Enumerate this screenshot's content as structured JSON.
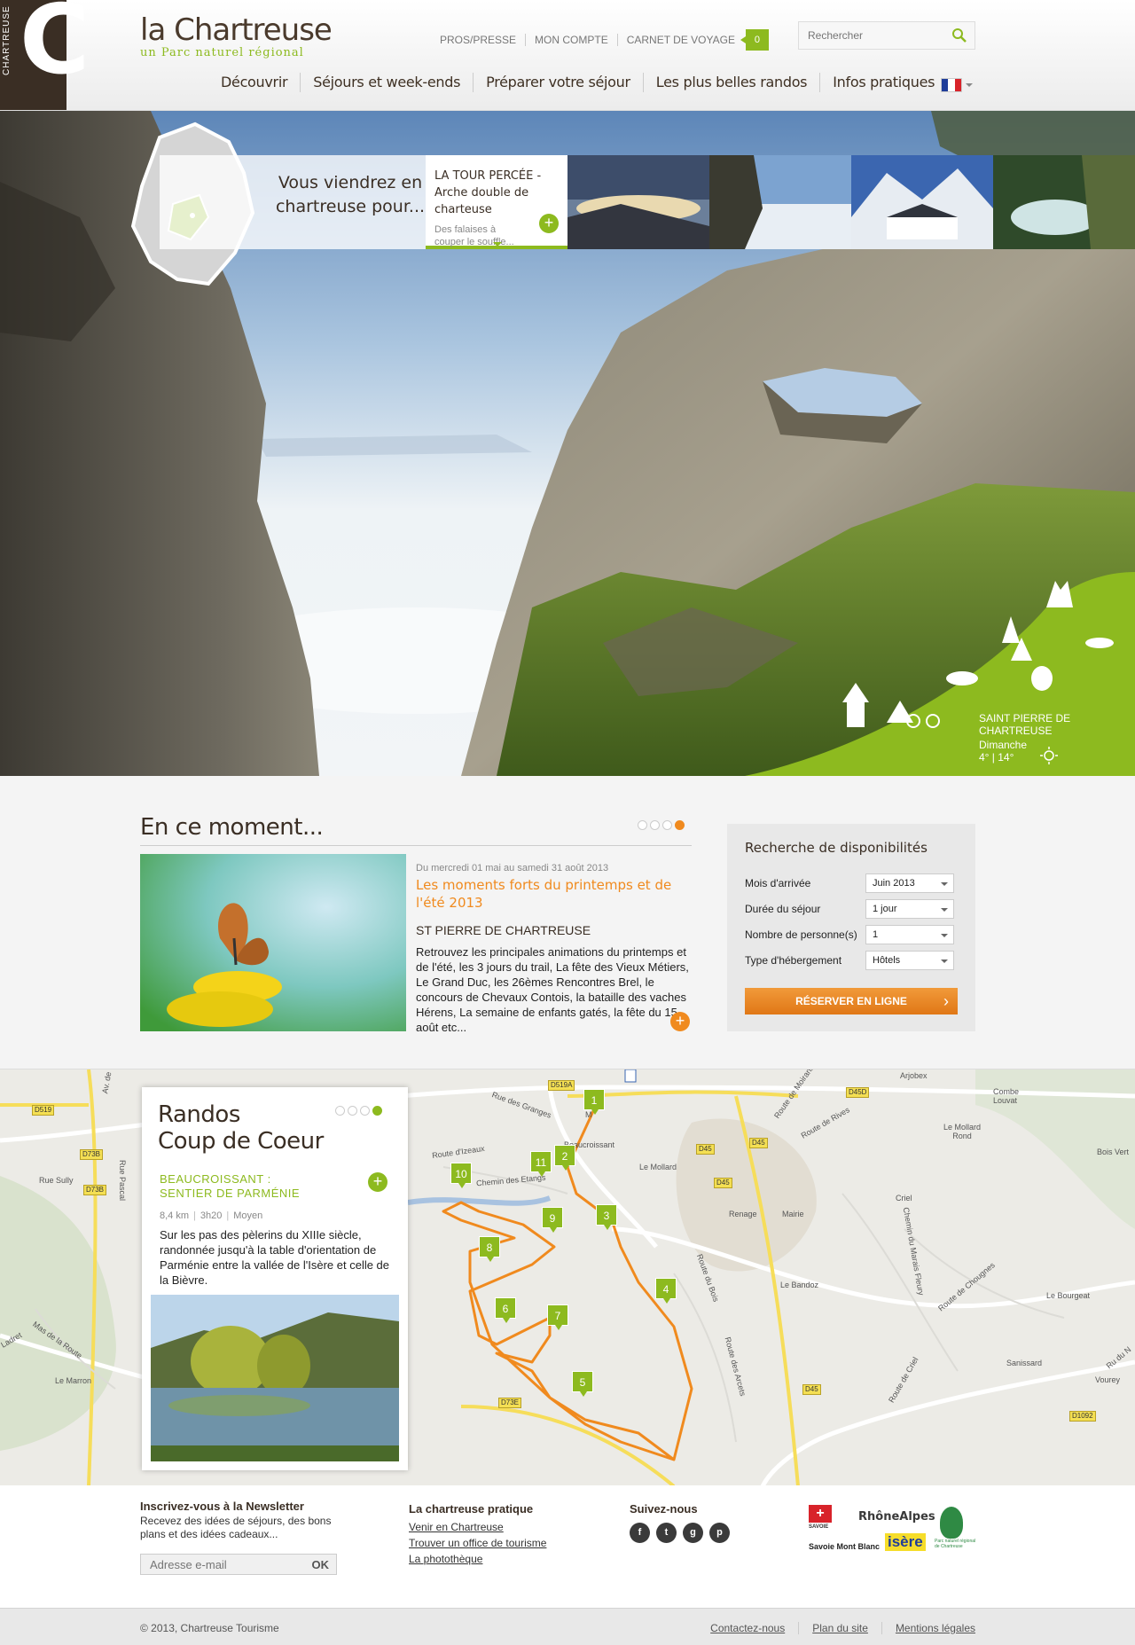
{
  "brand": {
    "side_text": "CHARTREUSE",
    "name": "la Chartreuse",
    "tagline": "un Parc naturel régional"
  },
  "toplinks": {
    "press": "PROS/PRESSE",
    "account": "MON COMPTE",
    "travel_book": "CARNET DE VOYAGE",
    "travel_count": "0"
  },
  "search": {
    "placeholder": "Rechercher",
    "icon": "search-icon"
  },
  "nav": {
    "items": [
      "Découvrir",
      "Séjours et week-ends",
      "Préparer votre séjour",
      "Les plus belles randos",
      "Infos pratiques"
    ],
    "language_flag": [
      "#1f3d99",
      "#ffffff",
      "#d8232a"
    ]
  },
  "hero": {
    "intro": "Vous viendrez en chartreuse pour...",
    "active_title": "LA TOUR PERCÉE - Arche double de charteuse",
    "active_desc": "Des falaises à couper le souffle...",
    "weather": {
      "city": "SAINT PIERRE DE CHARTREUSE",
      "day": "Dimanche",
      "temps": "4° | 14°"
    }
  },
  "moment": {
    "title": "En ce moment...",
    "dates": "Du mercredi 01 mai au samedi 31 août 2013",
    "event_title": "Les moments forts du printemps et de l'été 2013",
    "place": "ST PIERRE DE CHARTREUSE",
    "desc": "Retrouvez les principales animations du printemps et de l'été, les 3 jours du trail, La fête des Vieux Métiers, Le Grand Duc, les 26èmes Rencontres Brel, le concours de Chevaux Contois, la bataille des vaches Hérens, La semaine de enfants gatés, la fête du 15 août etc...",
    "more": "+"
  },
  "dispo": {
    "title": "Recherche de disponibilités",
    "fields": [
      {
        "label": "Mois d'arrivée",
        "value": "Juin 2013"
      },
      {
        "label": "Durée du séjour",
        "value": "1 jour"
      },
      {
        "label": "Nombre de personne(s)",
        "value": "1"
      },
      {
        "label": "Type d'hébergement",
        "value": "Hôtels"
      }
    ],
    "button": "RÉSERVER EN LIGNE",
    "button_chevron": "›"
  },
  "rando": {
    "title_line1": "Randos",
    "title_line2": "Coup de Coeur",
    "rtitle": "BEAUCROISSANT : SENTIER DE PARMÉNIE",
    "distance": "8,4 km",
    "duration": "3h20",
    "level": "Moyen",
    "desc": "Sur les pas des pèlerins du XIIIe siècle, randonnée jusqu'à la table d'orientation de Parménie entre la vallée de l'Isère et celle de la Bièvre.",
    "plus": "+"
  },
  "map": {
    "pins": [
      "1",
      "2",
      "3",
      "4",
      "5",
      "6",
      "7",
      "8",
      "9",
      "10",
      "11"
    ],
    "labels": [
      "Beaucroissant",
      "Le Mollard",
      "Renage",
      "Mairie",
      "Le Bandoz",
      "Criel",
      "Le Mollard Rond",
      "Bois Vert",
      "Combe Louvat",
      "Arjobex",
      "Le Bourgeat",
      "Sanissard",
      "Vourey",
      "Le Marron",
      "Rue des Granges",
      "Route d'Izeaux",
      "Chemin des Etangs",
      "Route de Rives",
      "Route de Moirans",
      "Route du Bois",
      "Route des Arcets",
      "Chemin du Marais Fleury",
      "Route de Chougnes",
      "Rue Sully",
      "Rue Pascal",
      "Mas de la Route",
      "Ladret",
      "Av. de",
      "Ru du N",
      "Route de Criel"
    ],
    "roads": [
      "D519A",
      "D519",
      "D73B",
      "D73B",
      "D45",
      "D45",
      "D45D",
      "D45",
      "D73E",
      "D45",
      "D1092"
    ]
  },
  "footer": {
    "newsletter_title": "Inscrivez-vous à la Newsletter",
    "newsletter_desc": "Recevez des idées de séjours, des bons plans et des idées cadeaux...",
    "email_placeholder": "Adresse e-mail",
    "ok": "OK",
    "pratique_title": "La chartreuse pratique",
    "pratique_links": [
      "Venir en Chartreuse",
      "Trouver un office de tourisme",
      "La photothèque"
    ],
    "social_title": "Suivez-nous",
    "social": [
      "f",
      "t",
      "g",
      "p"
    ],
    "partners": [
      "SAVOIE",
      "RhôneAlpes",
      "Savoie Mont Blanc",
      "isère",
      "Parc naturel régional de Chartreuse"
    ]
  },
  "bottom": {
    "copyright": "© 2013, Chartreuse Tourisme",
    "links": [
      "Contactez-nous",
      "Plan du site",
      "Mentions légales"
    ]
  },
  "colors": {
    "brand_brown": "#3a2e24",
    "green": "#8dba1f",
    "orange": "#f08a1e"
  }
}
